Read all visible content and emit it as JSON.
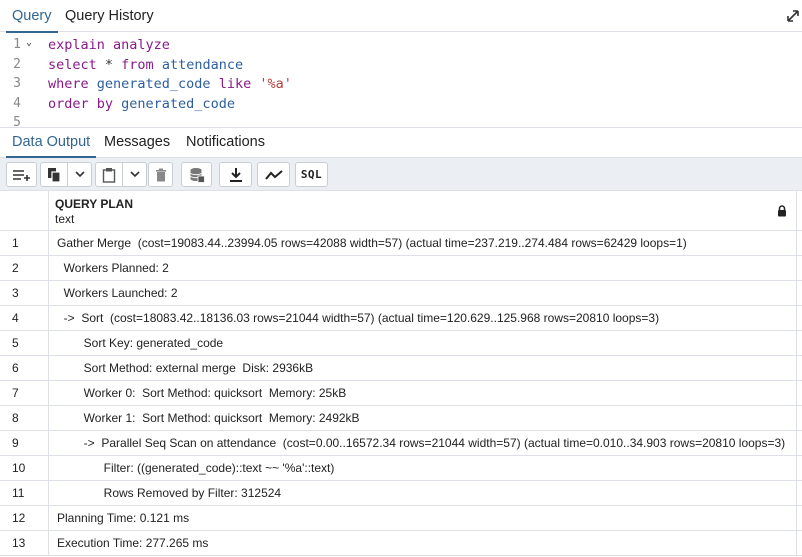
{
  "query_tabs": [
    {
      "label": "Query",
      "active": true
    },
    {
      "label": "Query History",
      "active": false
    }
  ],
  "editor": {
    "lines": [
      {
        "num": "1",
        "fold": "⌄",
        "tokens": [
          {
            "t": "explain analyze",
            "c": "kw"
          }
        ]
      },
      {
        "num": "2",
        "fold": "",
        "tokens": [
          {
            "t": "select",
            "c": "kw"
          },
          {
            "t": " * ",
            "c": "op"
          },
          {
            "t": "from",
            "c": "kw"
          },
          {
            "t": " attendance",
            "c": "id"
          }
        ]
      },
      {
        "num": "3",
        "fold": "",
        "tokens": [
          {
            "t": "where",
            "c": "kw"
          },
          {
            "t": " generated_code ",
            "c": "id"
          },
          {
            "t": "like",
            "c": "kw"
          },
          {
            "t": " '%a'",
            "c": "str"
          }
        ]
      },
      {
        "num": "4",
        "fold": "",
        "tokens": [
          {
            "t": "order by",
            "c": "kw"
          },
          {
            "t": " generated_code",
            "c": "id"
          }
        ]
      },
      {
        "num": "5",
        "fold": "",
        "tokens": []
      }
    ]
  },
  "result_tabs": [
    {
      "label": "Data Output",
      "active": true
    },
    {
      "label": "Messages",
      "active": false
    },
    {
      "label": "Notifications",
      "active": false
    }
  ],
  "toolbar": {
    "sql_label": "SQL"
  },
  "grid": {
    "column": {
      "name": "QUERY PLAN",
      "type": "text"
    },
    "rows": [
      {
        "n": "1",
        "text": "Gather Merge  (cost=19083.44..23994.05 rows=42088 width=57) (actual time=237.219..274.484 rows=62429 loops=1)"
      },
      {
        "n": "2",
        "text": "  Workers Planned: 2"
      },
      {
        "n": "3",
        "text": "  Workers Launched: 2"
      },
      {
        "n": "4",
        "text": "  ->  Sort  (cost=18083.42..18136.03 rows=21044 width=57) (actual time=120.629..125.968 rows=20810 loops=3)"
      },
      {
        "n": "5",
        "text": "        Sort Key: generated_code"
      },
      {
        "n": "6",
        "text": "        Sort Method: external merge  Disk: 2936kB"
      },
      {
        "n": "7",
        "text": "        Worker 0:  Sort Method: quicksort  Memory: 25kB"
      },
      {
        "n": "8",
        "text": "        Worker 1:  Sort Method: quicksort  Memory: 2492kB"
      },
      {
        "n": "9",
        "text": "        ->  Parallel Seq Scan on attendance  (cost=0.00..16572.34 rows=21044 width=57) (actual time=0.010..34.903 rows=20810 loops=3)"
      },
      {
        "n": "10",
        "text": "              Filter: ((generated_code)::text ~~ '%a'::text)"
      },
      {
        "n": "11",
        "text": "              Rows Removed by Filter: 312524"
      },
      {
        "n": "12",
        "text": "Planning Time: 0.121 ms"
      },
      {
        "n": "13",
        "text": "Execution Time: 277.265 ms"
      }
    ]
  },
  "colors": {
    "accent": "#326690",
    "keyword": "#8a1a8a",
    "identifier": "#2d5fa0",
    "string": "#b3403a"
  },
  "icons": [
    "expand-icon",
    "add-row-icon",
    "copy-icon",
    "chevron-down-icon",
    "paste-icon",
    "delete-icon",
    "save-data-icon",
    "download-icon",
    "graph-icon",
    "lock-icon"
  ]
}
